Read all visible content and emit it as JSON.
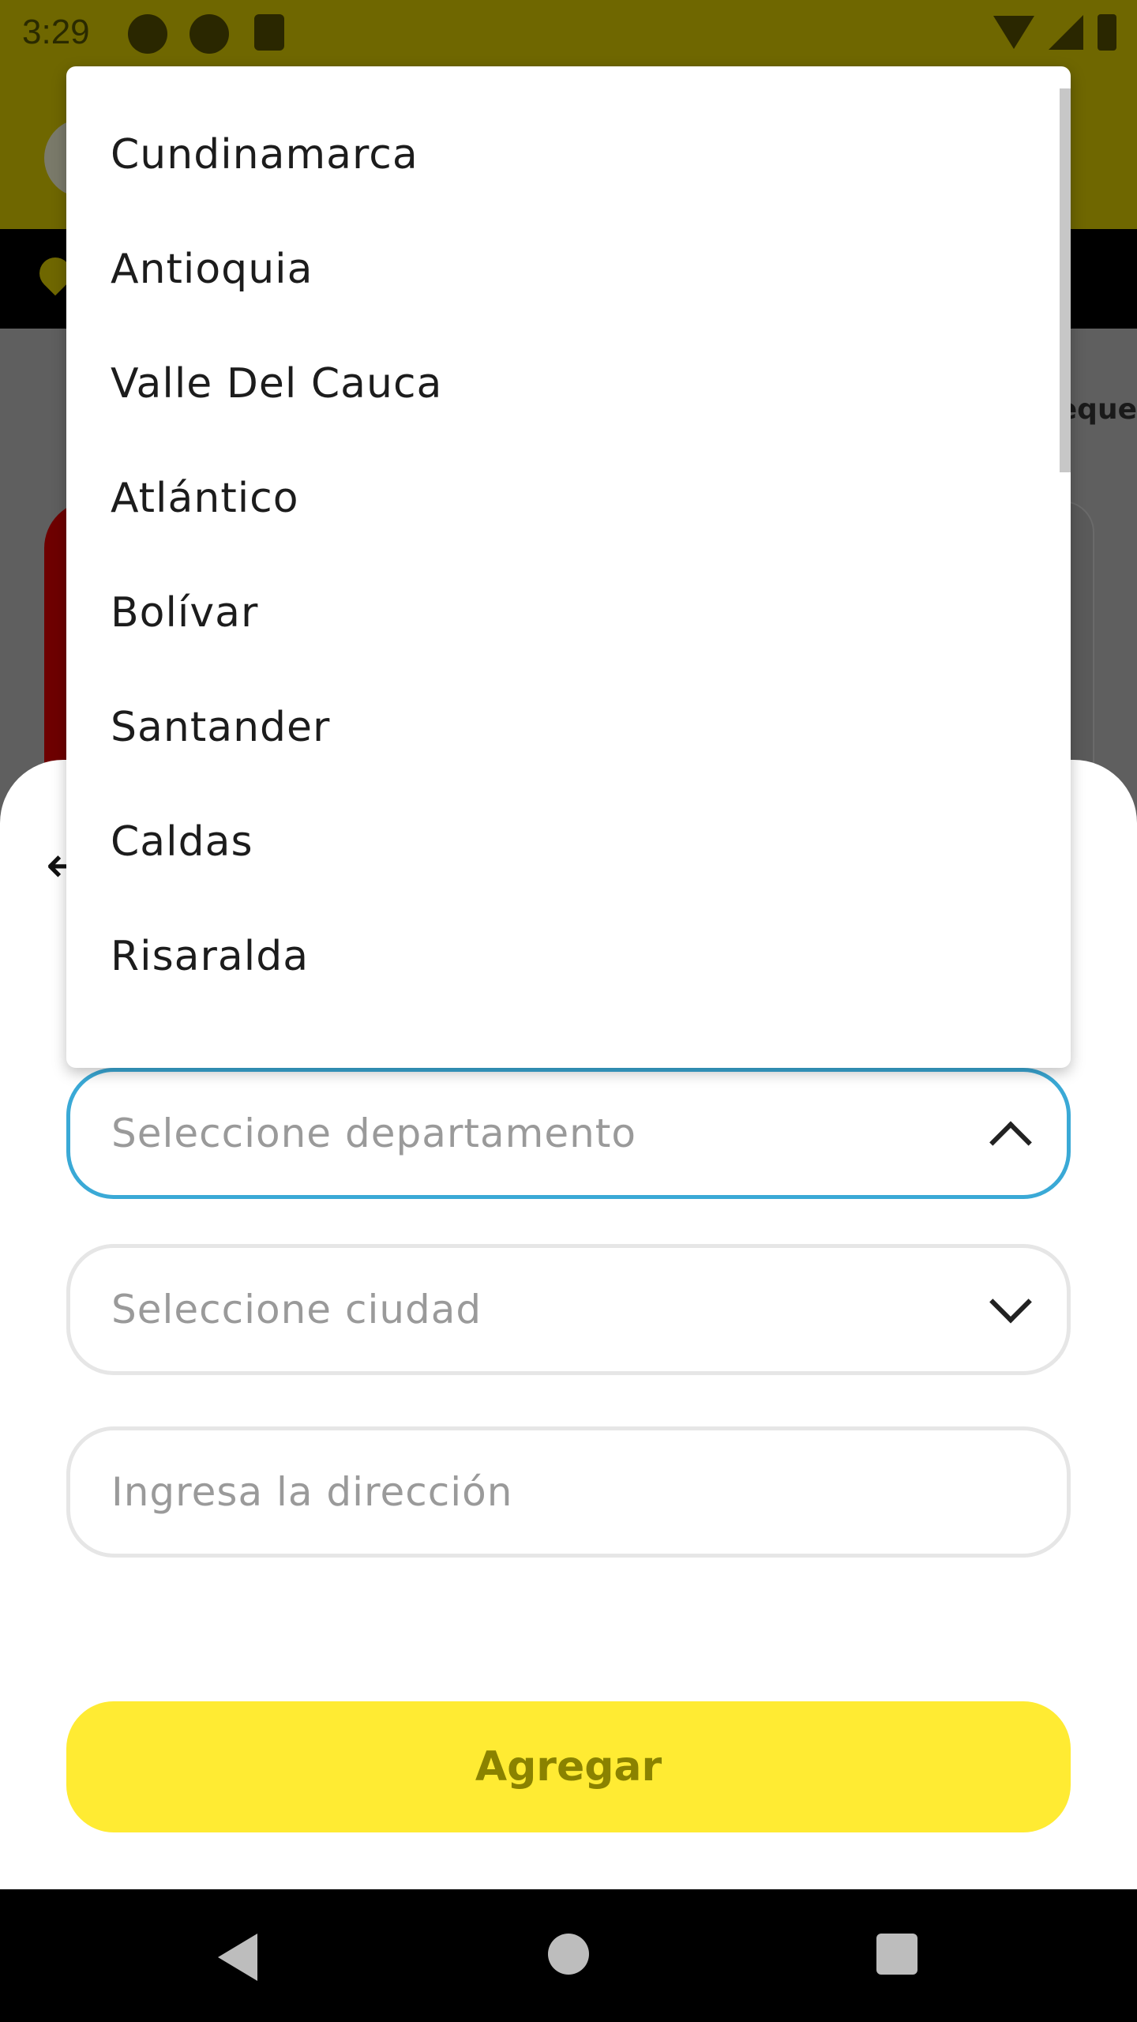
{
  "status_bar": {
    "time": "3:29",
    "icons": [
      "app-icon",
      "app-icon",
      "sd-card-icon",
      "wifi-icon",
      "signal-icon",
      "battery-icon"
    ]
  },
  "background": {
    "partial_text": "eque"
  },
  "dropdown": {
    "options": [
      "Cundinamarca",
      "Antioquia",
      "Valle Del Cauca",
      "Atlántico",
      "Bolívar",
      "Santander",
      "Caldas",
      "Risaralda"
    ]
  },
  "form": {
    "back_icon": "arrow-back-icon",
    "department": {
      "placeholder": "Seleccione departamento",
      "state": "expanded"
    },
    "city": {
      "placeholder": "Seleccione ciudad"
    },
    "address": {
      "placeholder": "Ingresa la dirección"
    },
    "submit_label": "Agregar"
  },
  "colors": {
    "accent_yellow": "#ffeb33",
    "active_border": "#3aa9d6",
    "button_text": "#8a8200"
  }
}
